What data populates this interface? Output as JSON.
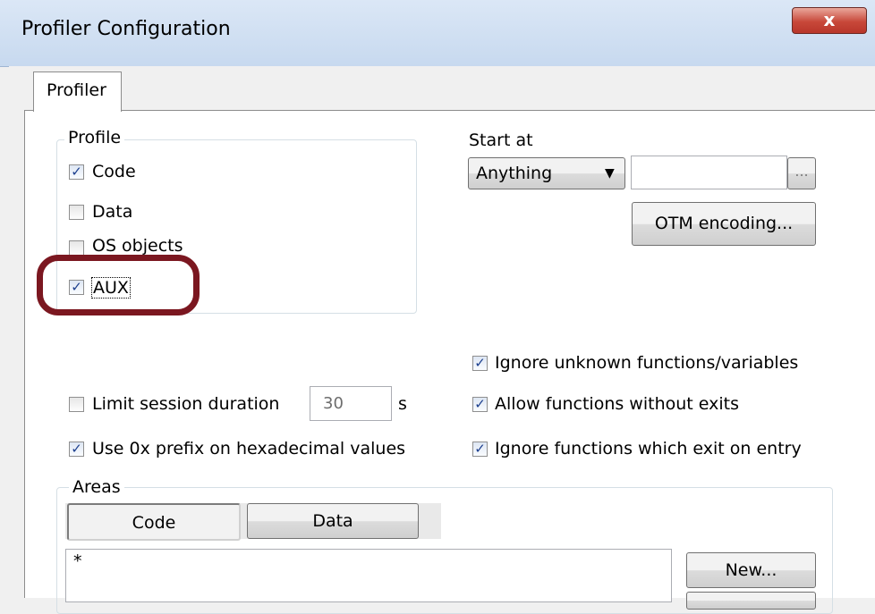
{
  "window": {
    "title": "Profiler Configuration",
    "close_glyph": "x"
  },
  "tabs": [
    {
      "label": "Profiler"
    }
  ],
  "profile": {
    "label": "Profile",
    "items": [
      {
        "label": "Code",
        "checked": true
      },
      {
        "label": "Data",
        "checked": false
      },
      {
        "label": "OS objects",
        "checked": false
      },
      {
        "label": "AUX",
        "checked": true
      }
    ]
  },
  "start_at": {
    "label": "Start at",
    "selected": "Anything",
    "value": "",
    "browse_label": "...",
    "encoding_button": "OTM encoding..."
  },
  "options": {
    "ignore_unknown": {
      "label": "Ignore unknown functions/variables",
      "checked": true
    },
    "limit_session": {
      "label": "Limit session duration",
      "checked": false,
      "value": "30",
      "unit": "s"
    },
    "allow_no_exits": {
      "label": "Allow functions without exits",
      "checked": true
    },
    "use_0x": {
      "label": "Use 0x prefix on hexadecimal values",
      "checked": true
    },
    "ignore_exit_entry": {
      "label": "Ignore functions which exit on entry",
      "checked": true
    }
  },
  "areas": {
    "label": "Areas",
    "tabs": [
      {
        "label": "Code",
        "active": true
      },
      {
        "label": "Data",
        "active": false
      }
    ],
    "list": [
      "*"
    ],
    "new_button": "New..."
  },
  "colors": {
    "highlight": "#7b1720",
    "check": "#1c3f8e"
  }
}
